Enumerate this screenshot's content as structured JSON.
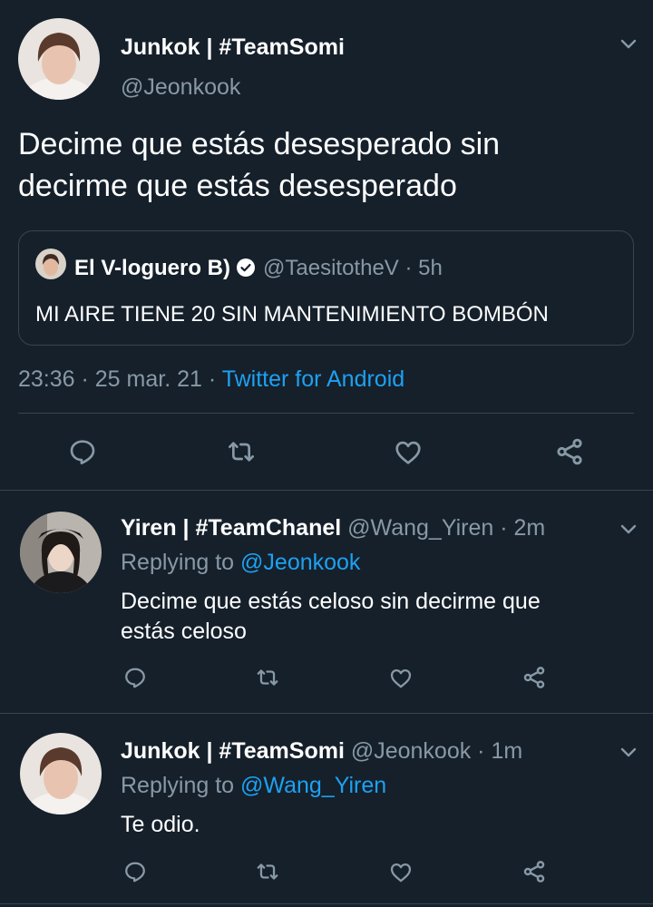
{
  "main_tweet": {
    "display_name": "Junkok | #TeamSomi",
    "handle": "@Jeonkook",
    "text_line1": "Decime que estás desesperado sin",
    "text_line2": "decirme que estás desesperado",
    "quoted": {
      "display_name": "El V-loguero B)",
      "handle_time": "@TaesitotheV · 5h",
      "text": "MI AIRE TIENE 20 SIN MANTENIMIENTO BOMBÓN"
    },
    "meta_time": "23:36 · 25 mar. 21 ·",
    "meta_source": "Twitter for Android"
  },
  "replies": [
    {
      "display_name": "Yiren | #TeamChanel",
      "handle_time": "@Wang_Yiren · 2m",
      "replying_label": "Replying to",
      "replying_to": "@Jeonkook",
      "text_line1": "Decime que estás celoso sin decirme que",
      "text_line2": "estás celoso"
    },
    {
      "display_name": "Junkok | #TeamSomi",
      "handle_time": "@Jeonkook · 1m",
      "replying_label": "Replying to",
      "replying_to": "@Wang_Yiren",
      "text_line1": "Te odio."
    }
  ],
  "icons": {
    "reply": "reply-icon",
    "retweet": "retweet-icon",
    "like": "like-icon",
    "share": "share-icon",
    "more": "chevron-down-icon",
    "verified": "verified-badge-icon"
  },
  "colors": {
    "background": "#15202b",
    "text": "#ffffff",
    "secondary": "#8899a6",
    "link": "#1da1f2",
    "divider": "#38444d"
  }
}
